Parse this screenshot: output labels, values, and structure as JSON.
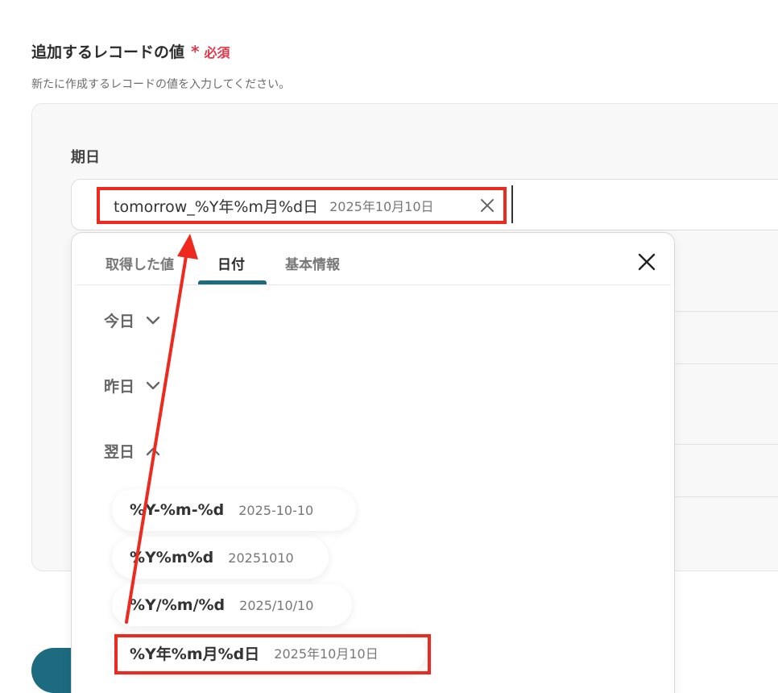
{
  "section": {
    "title": "追加するレコードの値",
    "required_mark": "*",
    "required_label": "必須",
    "description": "新たに作成するレコードの値を入力してください。"
  },
  "field": {
    "label": "期日",
    "chip": {
      "label": "tomorrow_%Y年%m月%d日",
      "value": "2025年10月10日"
    }
  },
  "dropdown": {
    "tabs": [
      {
        "label": "取得した値",
        "active": false
      },
      {
        "label": "日付",
        "active": true
      },
      {
        "label": "基本情報",
        "active": false
      }
    ],
    "groups": [
      {
        "label": "今日",
        "expanded": false
      },
      {
        "label": "昨日",
        "expanded": false
      },
      {
        "label": "翌日",
        "expanded": true
      }
    ],
    "options": [
      {
        "label": "%Y-%m-%d",
        "value": "2025-10-10"
      },
      {
        "label": "%Y%m%d",
        "value": "20251010"
      },
      {
        "label": "%Y/%m/%d",
        "value": "2025/10/10"
      },
      {
        "label": "%Y年%m月%d日",
        "value": "2025年10月10日",
        "highlighted": true
      }
    ]
  },
  "colors": {
    "accent": "#1c6b80",
    "required": "#e0394a",
    "highlight": "#ee2a1f"
  },
  "icons": [
    "close-icon",
    "chevron-down-icon",
    "chevron-up-icon",
    "arrow-annotation"
  ]
}
